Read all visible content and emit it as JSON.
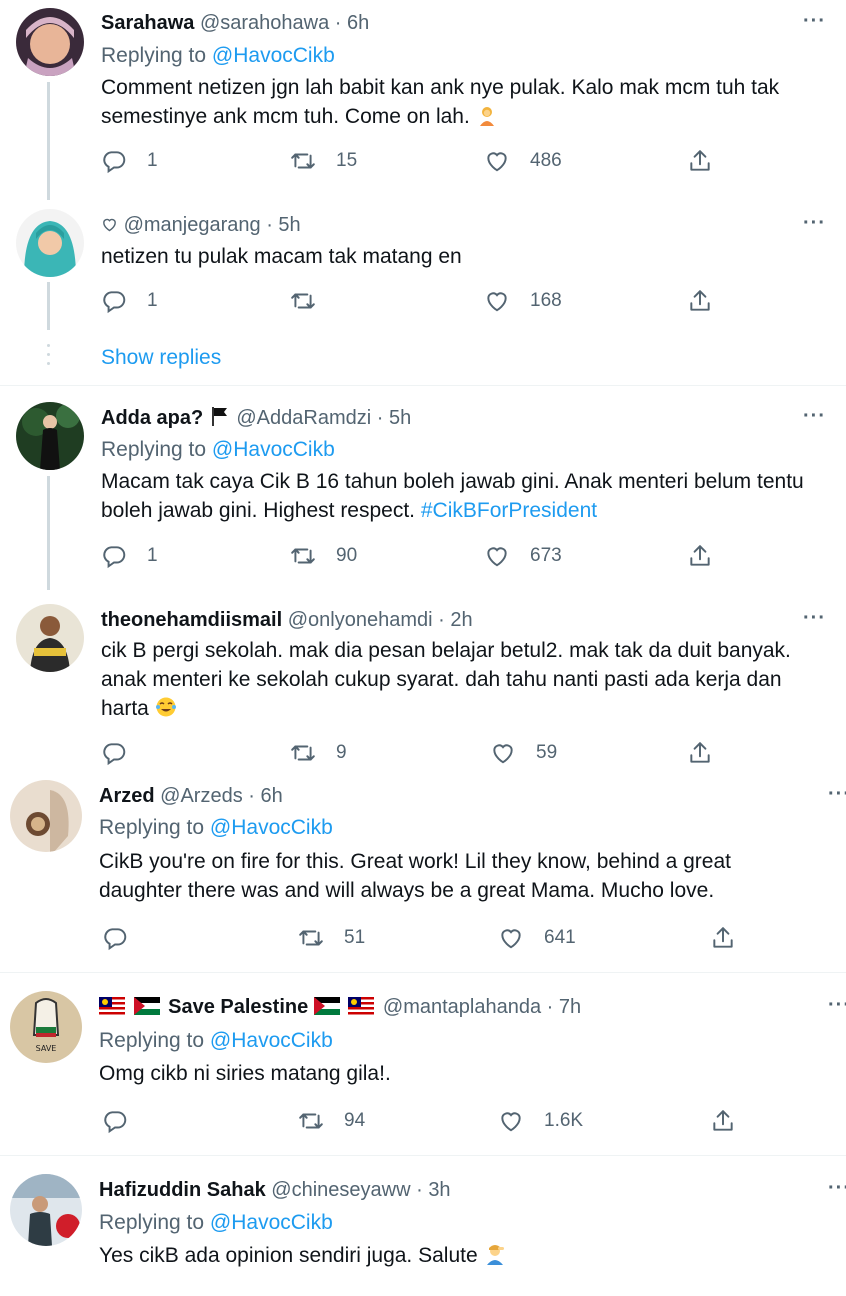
{
  "tweets": [
    {
      "name": "Sarahawa",
      "handle": "@sarahohawa",
      "time": "6h",
      "replying_label": "Replying to",
      "replying_to": "@HavocCikb",
      "text_lines": [
        "Comment netizen jgn lah babit kan ank nye pulak. Kalo mak mcm tuh tak",
        "semestinye ank mcm tuh. Come on lah."
      ],
      "replies": "1",
      "retweets": "15",
      "likes": "486"
    },
    {
      "name": "",
      "handle": "@manjegarang",
      "time": "5h",
      "text_lines": [
        "netizen tu pulak macam tak matang en"
      ],
      "replies": "1",
      "retweets": "",
      "likes": "168"
    },
    {
      "name": "Adda apa?",
      "handle": "@AddaRamdzi",
      "time": "5h",
      "replying_label": "Replying to",
      "replying_to": "@HavocCikb",
      "text_lines": [
        "Macam tak caya Cik B 16 tahun boleh jawab gini. Anak menteri belum tentu",
        "boleh jawab gini. Highest respect."
      ],
      "hashtag": "#CikBForPresident",
      "replies": "1",
      "retweets": "90",
      "likes": "673"
    },
    {
      "name": "theonehamdiismail",
      "handle": "@onlyonehamdi",
      "time": "2h",
      "text_lines": [
        "cik B pergi sekolah. mak dia pesan belajar betul2. mak tak da duit banyak.",
        "anak menteri ke sekolah cukup syarat. dah tahu nanti pasti ada kerja dan",
        "harta"
      ],
      "replies": "",
      "retweets": "9",
      "likes": "59"
    },
    {
      "name": "Arzed",
      "handle": "@Arzeds",
      "time": "6h",
      "replying_label": "Replying to",
      "replying_to": "@HavocCikb",
      "text_lines": [
        "CikB you're on fire for this. Great work! Lil they know, behind a great",
        "daughter there was and will always be a great Mama. Mucho love."
      ],
      "replies": "",
      "retweets": "51",
      "likes": "641"
    },
    {
      "name": "Save Palestine",
      "handle": "@mantaplahanda",
      "time": "7h",
      "replying_label": "Replying to",
      "replying_to": "@HavocCikb",
      "text_lines": [
        "Omg cikb ni siries matang gila!."
      ],
      "replies": "",
      "retweets": "94",
      "likes": "1.6K"
    },
    {
      "name": "Hafizuddin Sahak",
      "handle": "@chineseyaww",
      "time": "3h",
      "replying_label": "Replying to",
      "replying_to": "@HavocCikb",
      "text_lines": [
        "Yes cikB ada opinion sendiri juga. Salute"
      ],
      "replies": "",
      "retweets": "",
      "likes": ""
    }
  ],
  "show_replies": "Show replies",
  "separator": "·",
  "more_icon": "···",
  "colors": {
    "accent": "#1d9bf0",
    "secondary": "#536471",
    "thread": "#cfd9de"
  }
}
